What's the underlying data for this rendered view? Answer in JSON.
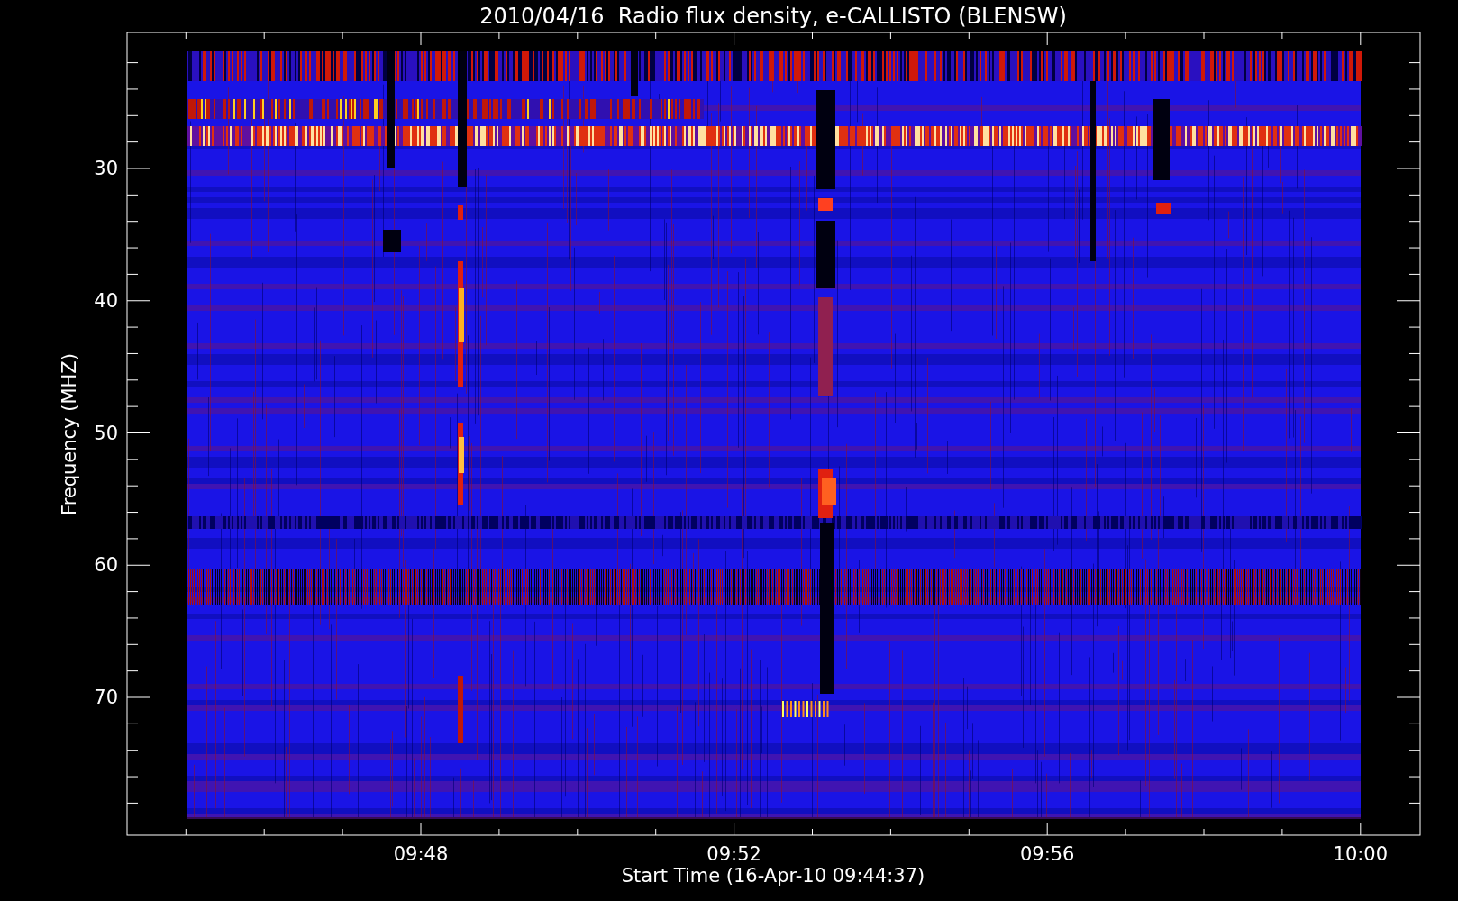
{
  "plot": {
    "title": "2010/04/16  Radio flux density, e-CALLISTO (BLENSW)",
    "xlabel": "Start Time (16-Apr-10 09:44:37)",
    "ylabel": "Frequency (MHZ)",
    "xticks": [
      "09:48",
      "09:52",
      "09:56",
      "10:00"
    ],
    "yticks": [
      "30",
      "40",
      "50",
      "60",
      "70"
    ]
  }
}
